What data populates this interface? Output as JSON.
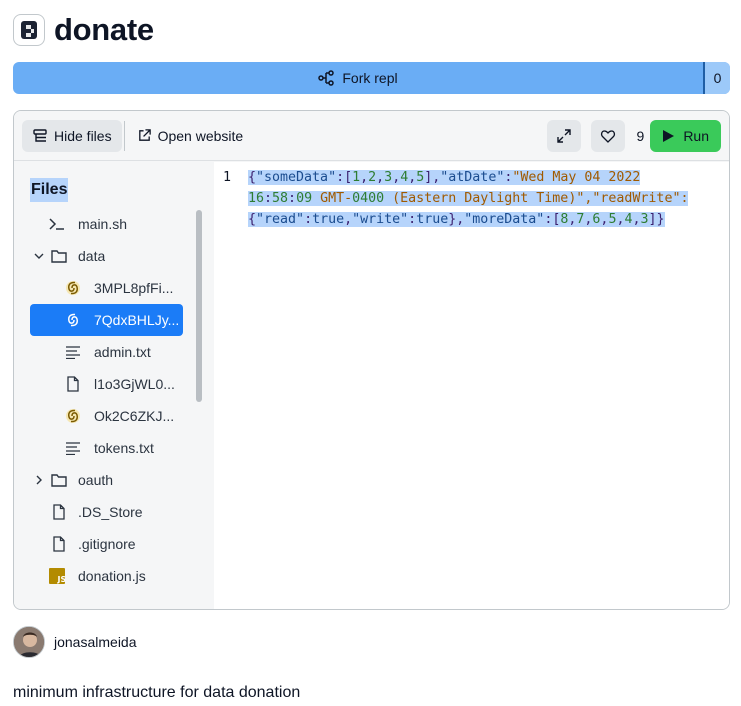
{
  "repl": {
    "title": "donate",
    "description": "minimum infrastructure for data donation"
  },
  "fork": {
    "label": "Fork repl",
    "count": "0"
  },
  "toolbar": {
    "hide_files": "Hide files",
    "open_website": "Open website",
    "likes": "9",
    "run": "Run"
  },
  "files": {
    "heading": "Files",
    "items": [
      {
        "label": "main.sh",
        "icon": "terminal-icon"
      },
      {
        "label": "data",
        "icon": "folder-icon",
        "expanded": true
      },
      {
        "label": "3MPL8pfFi...",
        "icon": "json-icon"
      },
      {
        "label": "7QdxBHLJy...",
        "icon": "json-icon",
        "selected": true
      },
      {
        "label": "admin.txt",
        "icon": "text-file-icon"
      },
      {
        "label": "l1o3GjWL0...",
        "icon": "file-icon"
      },
      {
        "label": "Ok2C6ZKJ...",
        "icon": "json-icon"
      },
      {
        "label": "tokens.txt",
        "icon": "text-file-icon"
      },
      {
        "label": "oauth",
        "icon": "folder-icon",
        "expanded": false
      },
      {
        "label": ".DS_Store",
        "icon": "file-icon"
      },
      {
        "label": ".gitignore",
        "icon": "file-icon"
      },
      {
        "label": "donation.js",
        "icon": "js-icon"
      }
    ]
  },
  "editor": {
    "line_number": "1",
    "lines": [
      "{\"someData\":[1,2,3,4,5],\"atDate\":\"Wed May 04 2022",
      "16:58:09 GMT-0400 (Eastern Daylight Time)\",\"readWrite\":",
      "{\"read\":true,\"write\":true},\"moreData\":[8,7,6,5,4,3]}"
    ]
  },
  "author": {
    "name": "jonasalmeida"
  },
  "colors": {
    "accent": "#6aadf5",
    "run": "#3aca5a",
    "selected": "#1b7cf7",
    "selection": "#b6d4fb"
  }
}
